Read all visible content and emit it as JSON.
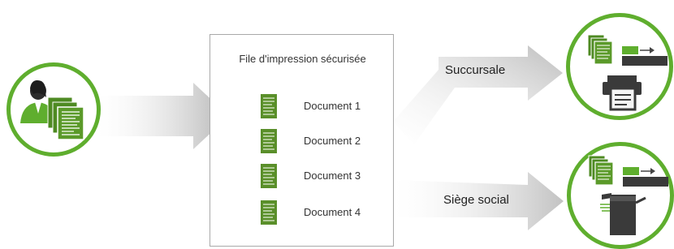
{
  "queue": {
    "title": "File d'impression sécurisée",
    "documents": [
      "Document 1",
      "Document 2",
      "Document 3",
      "Document 4"
    ]
  },
  "branches": {
    "top": "Succursale",
    "bottom": "Siège social"
  },
  "colors": {
    "accent_green": "#5fae2e",
    "arrow_gray": "#bdbdbd",
    "doc_green": "#5a8f2a"
  },
  "icons": {
    "sender": "user-with-documents-icon",
    "branch_office": "documents-printer-icon",
    "head_office": "documents-copier-icon"
  }
}
